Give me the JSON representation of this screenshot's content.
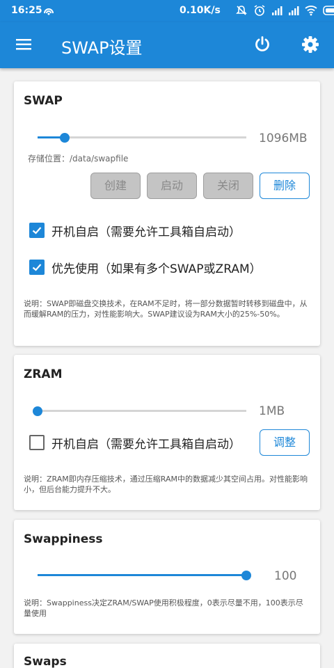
{
  "status_bar": {
    "time": "16:25",
    "net_speed": "0.10K/s",
    "icons": [
      "hotspot-icon",
      "mute-icon",
      "alarm-icon",
      "signal-icon",
      "signal-icon",
      "wifi-icon",
      "battery-icon"
    ]
  },
  "app_bar": {
    "title": "SWAP设置",
    "icons": [
      "menu-icon",
      "power-icon",
      "settings-icon"
    ]
  },
  "swap": {
    "title": "SWAP",
    "size": "1096MB",
    "size_fraction": 0.13,
    "location_label": "存储位置：/data/swapfile",
    "buttons": {
      "create": "创建",
      "start": "启动",
      "stop": "关闭",
      "delete": "删除"
    },
    "autostart_label": "开机自启（需要允许工具箱自启动）",
    "autostart_checked": true,
    "priority_label": "优先使用（如果有多个SWAP或ZRAM）",
    "priority_checked": true,
    "description": "说明：SWAP即磁盘交换技术，在RAM不足时，将一部分数据暂时转移到磁盘中，从而缓解RAM的压力，对性能影响大。SWAP建议设为RAM大小的25%-50%。"
  },
  "zram": {
    "title": "ZRAM",
    "size": "1MB",
    "size_fraction": 0.0,
    "autostart_label": "开机自启（需要允许工具箱自启动）",
    "autostart_checked": false,
    "adjust_button": "调整",
    "description": "说明：ZRAM即内存压缩技术，通过压缩RAM中的数据减少其空间占用。对性能影响小，但后台能力提升不大。"
  },
  "swappiness": {
    "title": "Swappiness",
    "value": "100",
    "fraction": 1.0,
    "description": "说明：Swappiness决定ZRAM/SWAP使用积极程度，0表示尽量不用，100表示尽量使用"
  },
  "swaps": {
    "title": "Swaps"
  },
  "colors": {
    "primary": "#1d87d8",
    "background": "#f2f2f2"
  }
}
